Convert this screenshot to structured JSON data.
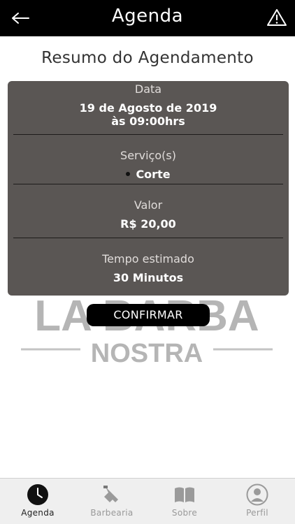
{
  "header": {
    "title": "Agenda",
    "back_icon": "arrow-left-icon",
    "warning_icon": "warning-triangle-icon"
  },
  "page": {
    "title": "Resumo do Agendamento"
  },
  "summary": {
    "date_label": "Data",
    "date_value": "19 de Agosto de 2019",
    "time_value": "às 09:00hrs",
    "services_label": "Serviço(s)",
    "services": [
      "Corte"
    ],
    "price_label": "Valor",
    "price_value": "R$ 20,00",
    "duration_label": "Tempo estimado",
    "duration_value": "30 Minutos"
  },
  "actions": {
    "confirm_label": "CONFIRMAR"
  },
  "watermark": {
    "line1": "LA BARBA",
    "line2": "NOSTRA"
  },
  "nav": {
    "items": [
      {
        "label": "Agenda",
        "icon": "clock-icon",
        "active": true
      },
      {
        "label": "Barbearia",
        "icon": "razor-icon",
        "active": false
      },
      {
        "label": "Sobre",
        "icon": "book-icon",
        "active": false
      },
      {
        "label": "Perfil",
        "icon": "user-icon",
        "active": false
      }
    ]
  },
  "colors": {
    "header_bg": "#000000",
    "card_bg": "#5a5654",
    "button_bg": "#000000",
    "nav_bg": "#efefef"
  }
}
